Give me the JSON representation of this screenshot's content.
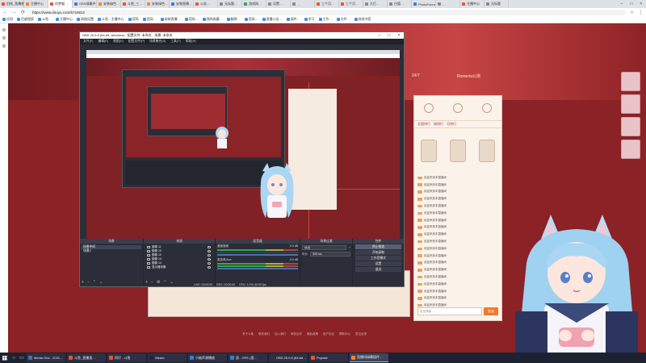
{
  "browser": {
    "tabs": [
      {
        "label": "旧帐_我播播播",
        "color": "#e9542c"
      },
      {
        "label": "主播中心",
        "color": "#f0842c"
      },
      {
        "label": "阿梦猫…",
        "color": "#e9542c"
      },
      {
        "label": "OBS绿幕中…",
        "color": "#3a7bd5"
      },
      {
        "label": "安装绿色…",
        "color": "#f0842c"
      },
      {
        "label": "斗鱼_三…",
        "color": "#e9542c"
      },
      {
        "label": "安装绿色…",
        "color": "#f0842c"
      },
      {
        "label": "安装直播…",
        "color": "#3a7bd5"
      },
      {
        "label": "公务…",
        "color": "#e9542c"
      },
      {
        "label": "无标题…",
        "color": "#888888"
      },
      {
        "label": "游戏网…",
        "color": "#3aa05a"
      },
      {
        "label": "设置…",
        "color": "#888888"
      },
      {
        "label": "…",
        "color": "#888888"
      },
      {
        "label": "三个月…",
        "color": "#e9542c"
      },
      {
        "label": "三个月…",
        "color": "#e9542c"
      },
      {
        "label": "大打…",
        "color": "#888888"
      },
      {
        "label": "白狐…",
        "color": "#888888"
      },
      {
        "label": "PhotoFunnel",
        "color": "#3a7bd5"
      },
      {
        "label": "…",
        "color": "#888888"
      },
      {
        "label": "主播中心",
        "color": "#e9542c"
      },
      {
        "label": "无标题",
        "color": "#888888"
      }
    ],
    "address": "https://www.douyu.com/5719812",
    "nav": {
      "back": "←",
      "forward": "→",
      "reload": "⟳"
    },
    "bookmarks": [
      "应用",
      "百度搜索",
      "斗鱼…",
      "主播中心",
      "网络设置",
      "斗鱼 - 主播中心",
      "官网",
      "官网…",
      "安装直播…",
      "官网…",
      "我的收藏…",
      "翻译…",
      "官网…",
      "直播公告…",
      "插件…",
      "学习",
      "工作…",
      "文件…",
      "其他书签"
    ]
  },
  "page": {
    "banner_labels": [
      {
        "text": "24/7"
      },
      {
        "text": "Romeria公测"
      }
    ],
    "footer_links": [
      "关于斗鱼",
      "联系我们",
      "加入我们",
      "商务合作",
      "隐私政策",
      "用户协议",
      "帮助中心",
      "意见反馈"
    ],
    "chat": {
      "tabs": [
        "全国排行",
        "周排行",
        "月排行"
      ],
      "message_text": "欢迎来到本直播间",
      "message_count": 19,
      "input_placeholder": "发送弹幕...",
      "send_label": "发送"
    }
  },
  "obs": {
    "title": "OBS 25.0.8 (64-bit, windows) - 配置文件: 未命名 - 场景: 未命名",
    "menu": [
      "文件(F)",
      "编辑(E)",
      "视图(V)",
      "配置文件(P)",
      "场景集合(S)",
      "工具(T)",
      "帮助(H)"
    ],
    "docks": {
      "scenes": {
        "title": "场景",
        "items": [
          "场景中间",
          "场景2"
        ]
      },
      "sources": {
        "title": "来源",
        "items": [
          "图像 11",
          "图像 10",
          "图像 12",
          "图像 13",
          "图像 14",
          "显示器采集"
        ]
      },
      "mixer": {
        "title": "混音器",
        "channels": [
          {
            "name": "桌面音频",
            "db": "0.0 dB"
          },
          {
            "name": "麦克风/Aux",
            "db": "0.0 dB"
          }
        ]
      },
      "transitions": {
        "title": "场景过渡",
        "type": "淡出",
        "duration_label": "时长",
        "duration": "300 ms"
      },
      "controls": {
        "title": "控件",
        "buttons": [
          "停止推流",
          "开始录制",
          "工作室模式",
          "设置",
          "退出"
        ]
      }
    },
    "status": {
      "live": "LIVE: 00:00:00",
      "rec": "REC: 00:00:00",
      "cpu": "CPU: 1.0%, 60.00 fps"
    },
    "dock_footer": [
      "+",
      "−",
      "⌃",
      "⌄"
    ]
  },
  "taskbar": {
    "apps": [
      {
        "label": "Media One - 2021…",
        "color": "#4a6fa5"
      },
      {
        "label": "斗鱼_直播直…",
        "color": "#e9542c"
      },
      {
        "label": "阿仔 - 斗鱼",
        "color": "#e9542c"
      },
      {
        "label": "Steam",
        "color": "#1b2838"
      },
      {
        "label": "小柚声源播放",
        "color": "#3a7bd5"
      },
      {
        "label": "直 - OPE (直…",
        "color": "#3a7bd5"
      },
      {
        "label": "OBS 25.0.8 (64-bit…",
        "color": "#333333"
      },
      {
        "label": "Popstar",
        "color": "#e9542c"
      },
      {
        "label": "直播间绿幕插件…",
        "color": "#f0842c",
        "active": true
      }
    ]
  },
  "colors": {
    "accent": "#f07a2c",
    "page_bg": "#7a1f22",
    "obs_bg": "#2b2e38"
  }
}
